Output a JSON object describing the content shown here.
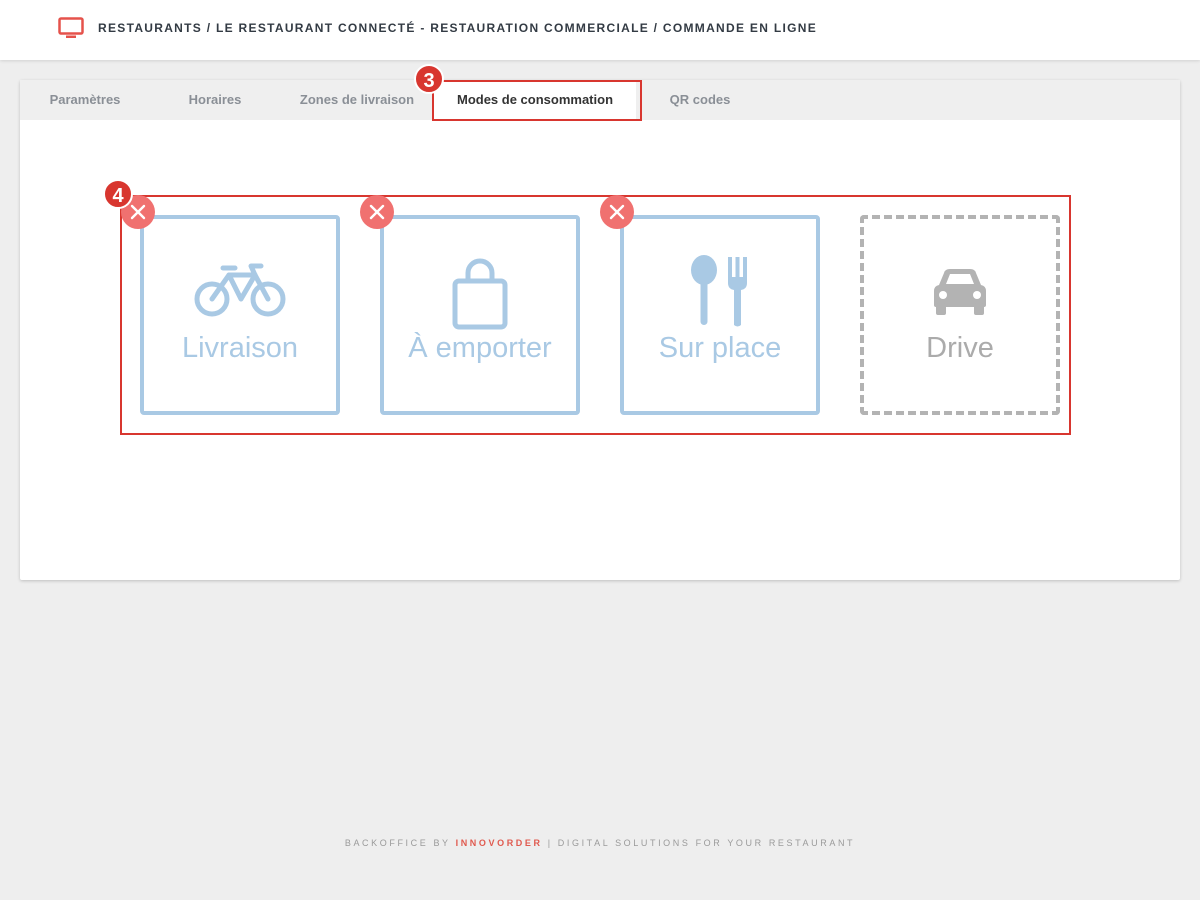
{
  "header": {
    "breadcrumb": "RESTAURANTS / LE RESTAURANT CONNECTÉ - RESTAURATION COMMERCIALE / COMMANDE EN LIGNE",
    "icon": "monitor-icon"
  },
  "tabs": [
    {
      "label": "Paramètres"
    },
    {
      "label": "Horaires"
    },
    {
      "label": "Zones de livraison"
    },
    {
      "label": "Modes de consommation",
      "active": true
    },
    {
      "label": "QR codes"
    }
  ],
  "annotations": {
    "step_tabs": "3",
    "step_modes": "4"
  },
  "modes": [
    {
      "label": "Livraison",
      "icon": "bicycle-icon",
      "enabled": true
    },
    {
      "label": "À emporter",
      "icon": "shopping-bag-icon",
      "enabled": true
    },
    {
      "label": "Sur place",
      "icon": "cutlery-icon",
      "enabled": true
    },
    {
      "label": "Drive",
      "icon": "car-icon",
      "enabled": false
    }
  ],
  "footer": {
    "prefix": "BACKOFFICE BY ",
    "brand": "INNOVORDER",
    "suffix": " | DIGITAL SOLUTIONS FOR YOUR RESTAURANT"
  },
  "colors": {
    "accent": "#d8362f",
    "mode_enabled": "#a9c9e4",
    "mode_disabled": "#b3b3b3",
    "remove_button": "#f07170",
    "brand": "#e05a4f"
  }
}
